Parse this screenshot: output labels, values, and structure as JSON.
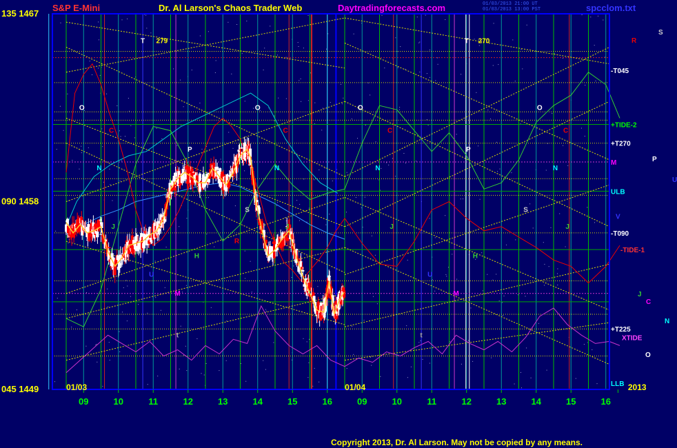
{
  "header": {
    "left_title": "S&P E-Mini",
    "center_title": "Dr. Al Larson's Chaos Trader Web",
    "site": "Daytradingforecasts.com",
    "file": "spcclom.txt",
    "stamp1": "01/03/2013 21:00 UT",
    "stamp2": "01/03/2013 13:00 PST"
  },
  "copyright": "Copyright 2013, Dr. Al Larson. May not be copied by any means.",
  "colors": {
    "background": "#000066",
    "plot_border": "#0000ff",
    "price_up": "#ffffff",
    "price_down": "#ff0000",
    "grid_green": "#00cc00",
    "flux_yellow": "#cccc00",
    "cyan": "#00cccc",
    "magenta": "#cc33cc",
    "red_curve": "#ee0000",
    "green_curve": "#33cc33"
  },
  "chart_data": {
    "type": "line",
    "y_axis_labels": [
      {
        "label": "135 1467",
        "value": 1467
      },
      {
        "label": "090 1458",
        "value": 1458
      },
      {
        "label": "045 1449",
        "value": 1449
      }
    ],
    "ylim": [
      1449,
      1467
    ],
    "x_tick_labels": [
      "09",
      "10",
      "11",
      "12",
      "13",
      "14",
      "15",
      "16",
      "09",
      "10",
      "11",
      "12",
      "13",
      "14",
      "15",
      "16"
    ],
    "session_labels": [
      "01/03",
      "01/04",
      "2013"
    ],
    "right_labels": [
      {
        "text": "-T045",
        "value": 1464.3,
        "color": "#ffffff"
      },
      {
        "text": "+TIDE-2",
        "value": 1461.7,
        "color": "#00ff00"
      },
      {
        "text": "+T270",
        "value": 1460.8,
        "color": "#ffffff"
      },
      {
        "text": "M",
        "value": 1459.9,
        "color": "#ff00ff"
      },
      {
        "text": "ULB",
        "value": 1458.5,
        "color": "#00ffff"
      },
      {
        "text": "V",
        "value": 1457.3,
        "color": "#3333ff"
      },
      {
        "text": "-T090",
        "value": 1456.5,
        "color": "#ffffff"
      },
      {
        "text": "-TIDE-1",
        "value": 1455.7,
        "color": "#ff3333"
      },
      {
        "text": "+T225",
        "value": 1451.9,
        "color": "#ffffff"
      },
      {
        "text": "XTIDE",
        "value": 1451.5,
        "color": "#ff44ff"
      },
      {
        "text": "LLB",
        "value": 1449.3,
        "color": "#00ffff"
      }
    ],
    "outside_letters": [
      {
        "text": "S",
        "color": "#cccccc"
      },
      {
        "text": "R",
        "color": "#ee0000"
      },
      {
        "text": "P",
        "color": "#ffffff"
      },
      {
        "text": "U",
        "color": "#3333ff"
      },
      {
        "text": "J",
        "color": "#33cc33"
      },
      {
        "text": "C",
        "color": "#ff00ff"
      },
      {
        "text": "N",
        "color": "#00ffff"
      },
      {
        "text": "O",
        "color": "#ffffff"
      }
    ],
    "plot_letters": [
      {
        "text": "T",
        "x": 2.2,
        "value": 1465.6,
        "color": "#ffffff"
      },
      {
        "text": "279",
        "x": 2.75,
        "value": 1465.6,
        "color": "#ffff00"
      },
      {
        "text": "T",
        "x": 11.5,
        "value": 1465.6,
        "color": "#ffffff"
      },
      {
        "text": "270",
        "x": 12.0,
        "value": 1465.6,
        "color": "#ffff00"
      },
      {
        "text": "O",
        "x": 0.45,
        "value": 1462.4,
        "color": "#ffffff"
      },
      {
        "text": "O",
        "x": 5.5,
        "value": 1462.4,
        "color": "#ffffff"
      },
      {
        "text": "O",
        "x": 8.45,
        "value": 1462.4,
        "color": "#ffffff"
      },
      {
        "text": "O",
        "x": 13.6,
        "value": 1462.4,
        "color": "#ffffff"
      },
      {
        "text": "C",
        "x": 1.3,
        "value": 1461.3,
        "color": "#ee0000"
      },
      {
        "text": "C",
        "x": 6.3,
        "value": 1461.3,
        "color": "#ee0000"
      },
      {
        "text": "C",
        "x": 9.3,
        "value": 1461.3,
        "color": "#ee0000"
      },
      {
        "text": "C",
        "x": 14.35,
        "value": 1461.3,
        "color": "#ee0000"
      },
      {
        "text": "P",
        "x": 3.55,
        "value": 1460.4,
        "color": "#ffffff"
      },
      {
        "text": "P",
        "x": 11.55,
        "value": 1460.4,
        "color": "#ffffff"
      },
      {
        "text": "N",
        "x": 0.95,
        "value": 1459.5,
        "color": "#00ffff"
      },
      {
        "text": "N",
        "x": 6.05,
        "value": 1459.5,
        "color": "#00ffff"
      },
      {
        "text": "N",
        "x": 8.95,
        "value": 1459.5,
        "color": "#00ffff"
      },
      {
        "text": "N",
        "x": 14.05,
        "value": 1459.5,
        "color": "#00ffff"
      },
      {
        "text": "S",
        "x": 5.2,
        "value": 1457.5,
        "color": "#cccccc"
      },
      {
        "text": "S",
        "x": 13.2,
        "value": 1457.5,
        "color": "#cccccc"
      },
      {
        "text": "J",
        "x": 1.35,
        "value": 1456.7,
        "color": "#33cc33"
      },
      {
        "text": "J",
        "x": 6.35,
        "value": 1456.7,
        "color": "#33cc33"
      },
      {
        "text": "J",
        "x": 9.35,
        "value": 1456.7,
        "color": "#33cc33"
      },
      {
        "text": "J",
        "x": 14.4,
        "value": 1456.7,
        "color": "#33cc33"
      },
      {
        "text": "R",
        "x": 4.9,
        "value": 1456.0,
        "color": "#ee0000"
      },
      {
        "text": "H",
        "x": 3.75,
        "value": 1455.3,
        "color": "#33cc33"
      },
      {
        "text": "H",
        "x": 11.75,
        "value": 1455.3,
        "color": "#33cc33"
      },
      {
        "text": "U",
        "x": 2.45,
        "value": 1454.4,
        "color": "#3333ff"
      },
      {
        "text": "U",
        "x": 10.45,
        "value": 1454.4,
        "color": "#3333ff"
      },
      {
        "text": "M",
        "x": 3.2,
        "value": 1453.5,
        "color": "#ff00ff"
      },
      {
        "text": "M",
        "x": 11.2,
        "value": 1453.5,
        "color": "#ff00ff"
      },
      {
        "text": "t",
        "x": 3.2,
        "value": 1451.5,
        "color": "#aaaaaa"
      },
      {
        "text": "t",
        "x": 10.2,
        "value": 1451.5,
        "color": "#aaaaaa"
      }
    ],
    "price_series": {
      "name": "",
      "x": [
        0.0,
        0.2,
        0.4,
        0.6,
        0.8,
        1.0,
        1.2,
        1.4,
        1.6,
        1.8,
        2.0,
        2.2,
        2.4,
        2.6,
        2.8,
        3.0,
        3.2,
        3.4,
        3.6,
        3.8,
        4.0,
        4.2,
        4.4,
        4.6,
        4.8,
        5.0,
        5.2,
        5.3,
        5.45,
        5.6,
        5.8,
        6.0,
        6.2,
        6.4,
        6.6,
        6.8,
        7.0,
        7.2,
        7.4,
        7.55,
        7.7,
        7.85,
        8.0
      ],
      "close": [
        1457.0,
        1456.5,
        1456.9,
        1456.5,
        1456.6,
        1456.8,
        1455.6,
        1454.9,
        1455.3,
        1455.9,
        1456.0,
        1456.1,
        1456.4,
        1456.6,
        1457.2,
        1458.6,
        1459.1,
        1459.4,
        1459.2,
        1458.9,
        1458.9,
        1459.6,
        1459.2,
        1458.8,
        1459.4,
        1460.2,
        1460.5,
        1460.1,
        1458.0,
        1456.8,
        1455.4,
        1455.7,
        1456.2,
        1456.6,
        1455.4,
        1454.4,
        1453.6,
        1452.8,
        1452.7,
        1454.2,
        1452.6,
        1453.3,
        1453.7
      ]
    },
    "series": [
      {
        "name": "",
        "color": "#00cccc",
        "x": [
          0.0,
          0.3,
          0.8,
          1.3,
          1.8,
          2.3,
          2.8,
          3.3,
          3.8,
          4.3,
          4.8,
          5.3,
          5.8,
          6.3,
          6.8,
          7.3,
          7.8
        ],
        "values": [
          1456.8,
          1458.0,
          1459.2,
          1459.8,
          1460.2,
          1460.4,
          1461.0,
          1461.6,
          1462.0,
          1462.4,
          1462.8,
          1463.2,
          1462.6,
          1461.0,
          1459.8,
          1458.9,
          1458.4
        ]
      },
      {
        "name": "",
        "color": "#3399ff",
        "x": [
          0.0,
          0.5,
          1.0,
          1.5,
          2.0,
          2.5,
          3.0,
          3.5,
          4.0,
          4.5,
          5.0,
          5.5,
          6.0,
          6.5,
          7.0,
          7.5,
          8.0
        ],
        "values": [
          1456.6,
          1456.9,
          1457.3,
          1457.6,
          1458.0,
          1458.2,
          1458.4,
          1458.6,
          1458.8,
          1458.9,
          1458.7,
          1458.3,
          1457.9,
          1457.4,
          1456.9,
          1456.5,
          1456.2
        ]
      },
      {
        "name": "",
        "color": "#33cc33",
        "x": [
          0.0,
          0.5,
          1.0,
          1.5,
          2.0,
          2.5,
          3.0,
          3.5,
          4.0,
          4.5,
          5.0,
          5.5,
          6.0,
          6.5,
          7.0,
          7.5,
          8.0,
          8.5,
          9.0,
          9.5,
          10.0,
          10.5,
          11.0,
          11.5,
          12.0,
          12.5,
          13.0,
          13.5,
          14.0,
          14.5,
          15.0,
          15.5,
          15.9
        ],
        "values": [
          1452.4,
          1452.0,
          1453.8,
          1456.8,
          1459.8,
          1461.6,
          1461.4,
          1459.8,
          1457.6,
          1456.1,
          1456.9,
          1458.6,
          1459.8,
          1458.8,
          1458.1,
          1458.4,
          1458.6,
          1460.8,
          1462.6,
          1462.4,
          1461.4,
          1460.4,
          1461.3,
          1460.2,
          1458.6,
          1458.9,
          1460.0,
          1461.8,
          1462.6,
          1463.1,
          1464.2,
          1463.6,
          1462.0
        ]
      },
      {
        "name": "",
        "color": "#ee0000",
        "x": [
          0.0,
          0.25,
          0.5,
          0.75,
          1.0,
          1.25,
          1.5,
          1.75,
          2.0,
          2.25,
          2.5,
          2.75,
          3.0,
          3.25,
          3.5,
          3.75,
          4.0,
          4.25,
          4.5,
          4.75,
          5.0,
          5.25,
          5.5,
          5.75,
          6.0,
          6.25,
          6.5,
          6.75,
          7.0,
          7.25,
          7.5,
          7.75,
          8.0,
          8.5,
          9.0,
          9.5,
          10.0,
          10.5,
          11.0,
          11.5,
          12.0,
          12.5,
          13.0,
          13.5,
          14.0,
          14.5,
          15.0,
          15.5,
          15.9
        ],
        "values": [
          1459.4,
          1463.2,
          1464.1,
          1464.6,
          1463.6,
          1462.2,
          1461.0,
          1459.5,
          1457.6,
          1456.4,
          1455.9,
          1456.2,
          1456.8,
          1457.6,
          1458.6,
          1459.6,
          1460.6,
          1461.6,
          1462.0,
          1461.6,
          1461.0,
          1460.0,
          1458.6,
          1457.0,
          1456.0,
          1455.1,
          1454.7,
          1454.2,
          1454.7,
          1455.2,
          1455.8,
          1456.6,
          1457.2,
          1456.0,
          1455.0,
          1454.9,
          1456.1,
          1457.6,
          1458.0,
          1457.2,
          1456.6,
          1456.8,
          1456.3,
          1455.8,
          1455.2,
          1454.9,
          1454.1,
          1454.9,
          1455.9
        ]
      },
      {
        "name": "",
        "color": "#cc33cc",
        "x": [
          0.0,
          0.4,
          0.8,
          1.2,
          1.6,
          2.0,
          2.4,
          2.8,
          3.2,
          3.6,
          4.0,
          4.4,
          4.8,
          5.2,
          5.6,
          6.0,
          6.4,
          6.8,
          7.2,
          7.6,
          8.0,
          8.4,
          8.8,
          9.2,
          9.6,
          10.0,
          10.4,
          10.8,
          11.2,
          11.6,
          12.0,
          12.4,
          12.8,
          13.2,
          13.6,
          14.0,
          14.4,
          14.8,
          15.2,
          15.6,
          15.9
        ],
        "values": [
          1449.8,
          1450.4,
          1451.0,
          1451.6,
          1451.2,
          1450.8,
          1451.3,
          1450.6,
          1450.9,
          1450.4,
          1451.1,
          1450.7,
          1451.4,
          1451.2,
          1453.0,
          1451.8,
          1451.1,
          1450.7,
          1451.1,
          1450.4,
          1450.1,
          1450.5,
          1450.3,
          1450.8,
          1450.6,
          1451.0,
          1451.3,
          1450.7,
          1451.6,
          1451.2,
          1450.9,
          1451.3,
          1450.8,
          1451.5,
          1452.5,
          1452.9,
          1452.1,
          1451.6,
          1451.2,
          1451.3,
          1451.1
        ]
      }
    ]
  }
}
